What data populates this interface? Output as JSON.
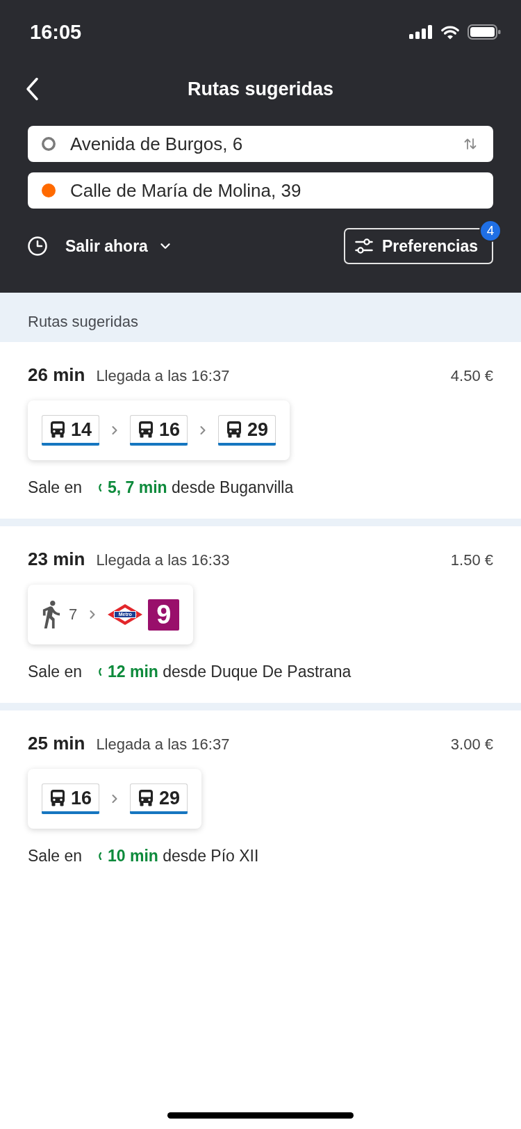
{
  "status_bar": {
    "time": "16:05"
  },
  "header": {
    "title": "Rutas sugeridas"
  },
  "route_fields": [
    {
      "kind": "origin",
      "value": "Avenida de Burgos, 6",
      "color": "#7b7b7b"
    },
    {
      "kind": "destination",
      "value": "Calle de María de Molina, 39",
      "color": "#ff6a00"
    }
  ],
  "departure_picker": {
    "label": "Salir ahora"
  },
  "preferences_button": {
    "label": "Preferencias",
    "badge": "4"
  },
  "section_title": "Rutas sugeridas",
  "routes": [
    {
      "duration": "26 min",
      "arrival": "Llegada a las 16:37",
      "price": "4.50 €",
      "legs": [
        {
          "kind": "bus",
          "line": "14",
          "color": "#1676c0"
        },
        {
          "kind": "bus",
          "line": "16",
          "color": "#1676c0"
        },
        {
          "kind": "bus",
          "line": "29",
          "color": "#1676c0"
        }
      ],
      "departs_label": "Sale en",
      "departs_in": "5, 7 min",
      "departs_from": "desde Buganvilla"
    },
    {
      "duration": "23 min",
      "arrival": "Llegada a las 16:33",
      "price": "1.50 €",
      "legs": [
        {
          "kind": "walk",
          "minutes": "7"
        },
        {
          "kind": "metro",
          "logo_text": "Metro",
          "line": "9",
          "color": "#990f6b"
        }
      ],
      "departs_label": "Sale en",
      "departs_in": "12 min",
      "departs_from": "desde Duque De Pastrana"
    },
    {
      "duration": "25 min",
      "arrival": "Llegada a las 16:37",
      "price": "3.00 €",
      "legs": [
        {
          "kind": "bus",
          "line": "16",
          "color": "#1676c0"
        },
        {
          "kind": "bus",
          "line": "29",
          "color": "#1676c0"
        }
      ],
      "departs_label": "Sale en",
      "departs_in": "10 min",
      "departs_from": "desde Pío XII"
    }
  ]
}
